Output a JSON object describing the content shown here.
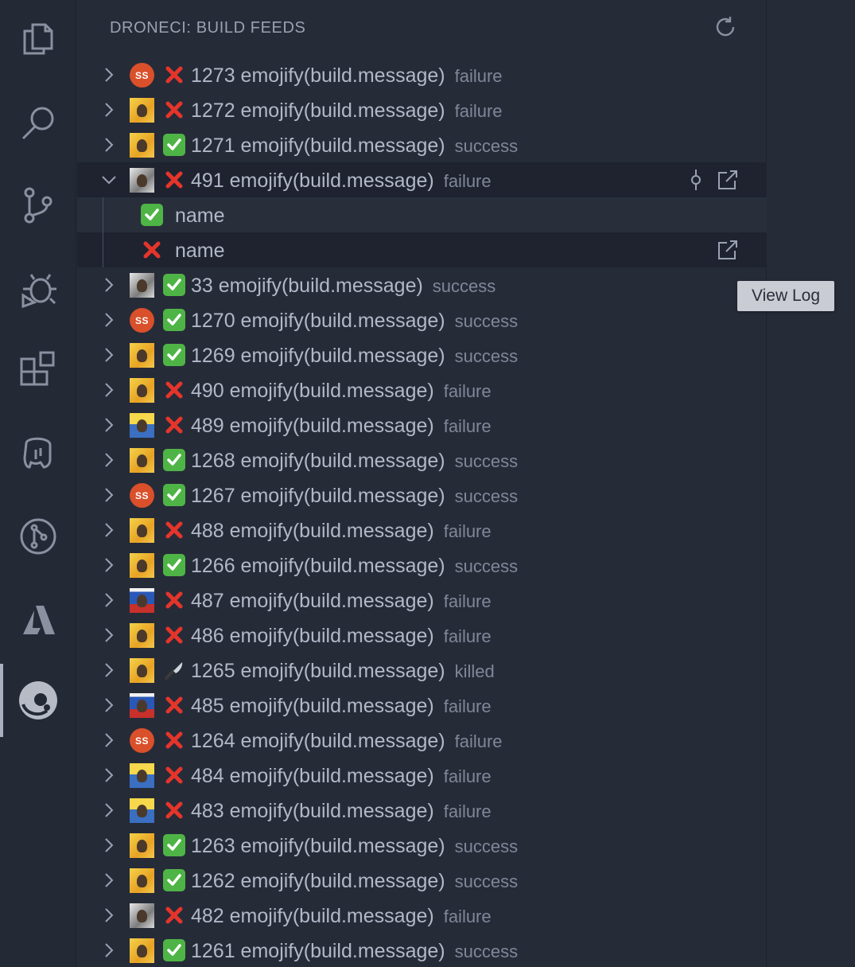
{
  "panel": {
    "title": "DRONECI: BUILD FEEDS"
  },
  "activity_bar": [
    {
      "name": "explorer-icon"
    },
    {
      "name": "search-icon"
    },
    {
      "name": "source-control-icon"
    },
    {
      "name": "debug-icon"
    },
    {
      "name": "extensions-icon"
    },
    {
      "name": "postgres-icon"
    },
    {
      "name": "gitlens-icon"
    },
    {
      "name": "azure-icon"
    },
    {
      "name": "droneci-icon",
      "active": true
    }
  ],
  "builds": [
    {
      "avatar": "initials",
      "initials": "SS",
      "status": "failure",
      "text": "1273 emojify(build.message)",
      "status_text": "failure"
    },
    {
      "avatar": "photo-yellow",
      "status": "failure",
      "text": "1272 emojify(build.message)",
      "status_text": "failure"
    },
    {
      "avatar": "photo-yellow",
      "status": "success",
      "text": "1271 emojify(build.message)",
      "status_text": "success"
    },
    {
      "avatar": "photo-bw",
      "status": "failure",
      "text": "491 emojify(build.message)",
      "status_text": "failure",
      "expanded": true,
      "children": [
        {
          "status": "success",
          "label": "name"
        },
        {
          "status": "failure",
          "label": "name"
        }
      ]
    },
    {
      "avatar": "photo-bw",
      "status": "success",
      "text": "33 emojify(build.message)",
      "status_text": "success"
    },
    {
      "avatar": "initials",
      "initials": "SS",
      "status": "success",
      "text": "1270 emojify(build.message)",
      "status_text": "success"
    },
    {
      "avatar": "photo-yellow",
      "status": "success",
      "text": "1269 emojify(build.message)",
      "status_text": "success"
    },
    {
      "avatar": "photo-yellow",
      "status": "failure",
      "text": "490 emojify(build.message)",
      "status_text": "failure"
    },
    {
      "avatar": "photo-minion",
      "status": "failure",
      "text": "489 emojify(build.message)",
      "status_text": "failure"
    },
    {
      "avatar": "photo-yellow",
      "status": "success",
      "text": "1268 emojify(build.message)",
      "status_text": "success"
    },
    {
      "avatar": "initials",
      "initials": "SS",
      "status": "success",
      "text": "1267 emojify(build.message)",
      "status_text": "success"
    },
    {
      "avatar": "photo-yellow",
      "status": "failure",
      "text": "488 emojify(build.message)",
      "status_text": "failure"
    },
    {
      "avatar": "photo-yellow",
      "status": "success",
      "text": "1266 emojify(build.message)",
      "status_text": "success"
    },
    {
      "avatar": "photo-cap",
      "status": "failure",
      "text": "487 emojify(build.message)",
      "status_text": "failure"
    },
    {
      "avatar": "photo-yellow",
      "status": "failure",
      "text": "486 emojify(build.message)",
      "status_text": "failure"
    },
    {
      "avatar": "photo-yellow",
      "status": "killed",
      "text": "1265 emojify(build.message)",
      "status_text": "killed"
    },
    {
      "avatar": "photo-cap",
      "status": "failure",
      "text": "485 emojify(build.message)",
      "status_text": "failure"
    },
    {
      "avatar": "initials",
      "initials": "SS",
      "status": "failure",
      "text": "1264 emojify(build.message)",
      "status_text": "failure"
    },
    {
      "avatar": "photo-minion",
      "status": "failure",
      "text": "484 emojify(build.message)",
      "status_text": "failure"
    },
    {
      "avatar": "photo-minion",
      "status": "failure",
      "text": "483 emojify(build.message)",
      "status_text": "failure"
    },
    {
      "avatar": "photo-yellow",
      "status": "success",
      "text": "1263 emojify(build.message)",
      "status_text": "success"
    },
    {
      "avatar": "photo-yellow",
      "status": "success",
      "text": "1262 emojify(build.message)",
      "status_text": "success"
    },
    {
      "avatar": "photo-bw",
      "status": "failure",
      "text": "482 emojify(build.message)",
      "status_text": "failure"
    },
    {
      "avatar": "photo-yellow",
      "status": "success",
      "text": "1261 emojify(build.message)",
      "status_text": "success"
    }
  ],
  "tooltip": {
    "text": "View Log"
  },
  "colors": {
    "failure": "#e5352b",
    "success": "#4fb446",
    "background": "#262b38"
  }
}
